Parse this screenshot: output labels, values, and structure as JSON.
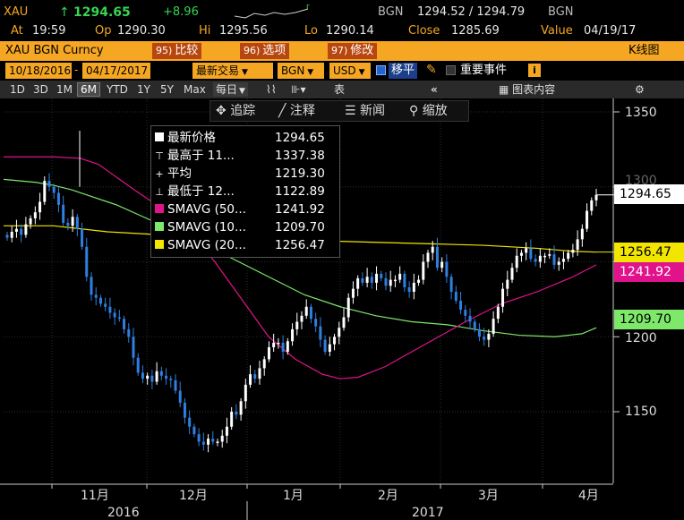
{
  "quote": {
    "ticker": "XAU",
    "arrow": "↑",
    "last": "1294.65",
    "change": "+8.96",
    "bid_src": "BGN",
    "bid_ask": "1294.52 / 1294.79",
    "ask_src": "BGN",
    "at_label": "At",
    "at": "19:59",
    "op_label": "Op",
    "open": "1290.30",
    "hi_label": "Hi",
    "high": "1295.56",
    "lo_label": "Lo",
    "low": "1290.14",
    "close_label": "Close",
    "close": "1285.69",
    "value_label": "Value",
    "value_date": "04/19/17"
  },
  "titlebar": {
    "security": "XAU BGN Curncy",
    "btn_compare_num": "95)",
    "btn_compare": "比较",
    "btn_options_num": "96)",
    "btn_options": "选项",
    "btn_edit_num": "97)",
    "btn_edit": "修改",
    "chart_name": "K线图"
  },
  "controls": {
    "date_from": "10/18/2016",
    "date_to": "04/17/2017",
    "price_type": "最新交易",
    "source": "BGN",
    "currency": "USD",
    "move_label": "移平",
    "events_label": "重要事件",
    "info_icon": "i"
  },
  "ranges": {
    "items": [
      "1D",
      "3D",
      "1M",
      "6M",
      "YTD",
      "1Y",
      "5Y",
      "Max"
    ],
    "selected": "6M",
    "period": "每日",
    "table": "表",
    "chart_content": "图表内容"
  },
  "chart_tools": {
    "track": "追踪",
    "annotate": "注释",
    "news": "新闻",
    "zoom": "缩放"
  },
  "legend": [
    {
      "label": "最新价格",
      "value": "1294.65",
      "swatch": "#ffffff",
      "kind": "box"
    },
    {
      "label": "最高于 11...",
      "value": "1337.38",
      "swatch": "",
      "kind": "high"
    },
    {
      "label": "平均",
      "value": "1219.30",
      "swatch": "",
      "kind": "avg"
    },
    {
      "label": "最低于 12...",
      "value": "1122.89",
      "swatch": "",
      "kind": "low"
    },
    {
      "label": "SMAVG (50...",
      "value": "1241.92",
      "swatch": "#e0138c",
      "kind": "box"
    },
    {
      "label": "SMAVG (10...",
      "value": "1209.70",
      "swatch": "#7ee86b",
      "kind": "box"
    },
    {
      "label": "SMAVG (20...",
      "value": "1256.47",
      "swatch": "#f2e600",
      "kind": "box"
    }
  ],
  "price_labels": [
    {
      "value": "1294.65",
      "bg": "#ffffff",
      "fg": "#000000"
    },
    {
      "value": "1256.47",
      "bg": "#f2e600",
      "fg": "#000000"
    },
    {
      "value": "1241.92",
      "bg": "#e0138c",
      "fg": "#ffffff"
    },
    {
      "value": "1209.70",
      "bg": "#7ee86b",
      "fg": "#000000"
    }
  ],
  "y_ticks": [
    "1350",
    "1300",
    "1250",
    "1200",
    "1150"
  ],
  "x_months": [
    "11月",
    "12月",
    "1月",
    "2月",
    "3月",
    "4月"
  ],
  "x_years": [
    "2016",
    "2017"
  ],
  "colors": {
    "accent": "#f5a623",
    "up_candle": "#ffffff",
    "down_candle": "#2f7fe0",
    "sma50": "#e0138c",
    "sma100": "#7ee86b",
    "sma200": "#f2e600"
  },
  "chart_data": {
    "type": "candlestick",
    "ylim": [
      1100,
      1360
    ],
    "series": [
      {
        "name": "SMAVG (50...",
        "last": 1241.92
      },
      {
        "name": "SMAVG (10...",
        "last": 1209.7
      },
      {
        "name": "SMAVG (20...",
        "last": 1256.47
      }
    ],
    "closes": [
      1266,
      1270,
      1272,
      1268,
      1275,
      1279,
      1283,
      1290,
      1304,
      1300,
      1296,
      1288,
      1276,
      1274,
      1280,
      1272,
      1260,
      1240,
      1228,
      1226,
      1222,
      1220,
      1216,
      1213,
      1212,
      1205,
      1200,
      1186,
      1176,
      1172,
      1174,
      1170,
      1177,
      1174,
      1172,
      1171,
      1164,
      1156,
      1146,
      1140,
      1135,
      1130,
      1128,
      1132,
      1130,
      1130,
      1134,
      1140,
      1150,
      1148,
      1157,
      1168,
      1175,
      1172,
      1179,
      1185,
      1193,
      1196,
      1196,
      1190,
      1197,
      1205,
      1210,
      1214,
      1220,
      1212,
      1207,
      1198,
      1190,
      1195,
      1200,
      1206,
      1213,
      1226,
      1232,
      1239,
      1236,
      1240,
      1236,
      1242,
      1239,
      1234,
      1238,
      1238,
      1242,
      1233,
      1230,
      1236,
      1238,
      1250,
      1256,
      1260,
      1246,
      1250,
      1240,
      1230,
      1224,
      1218,
      1214,
      1210,
      1205,
      1200,
      1198,
      1202,
      1212,
      1220,
      1232,
      1238,
      1246,
      1254,
      1256,
      1259,
      1252,
      1250,
      1254,
      1254,
      1255,
      1248,
      1250,
      1252,
      1256,
      1258,
      1265,
      1272,
      1284,
      1291,
      1294.65
    ]
  }
}
